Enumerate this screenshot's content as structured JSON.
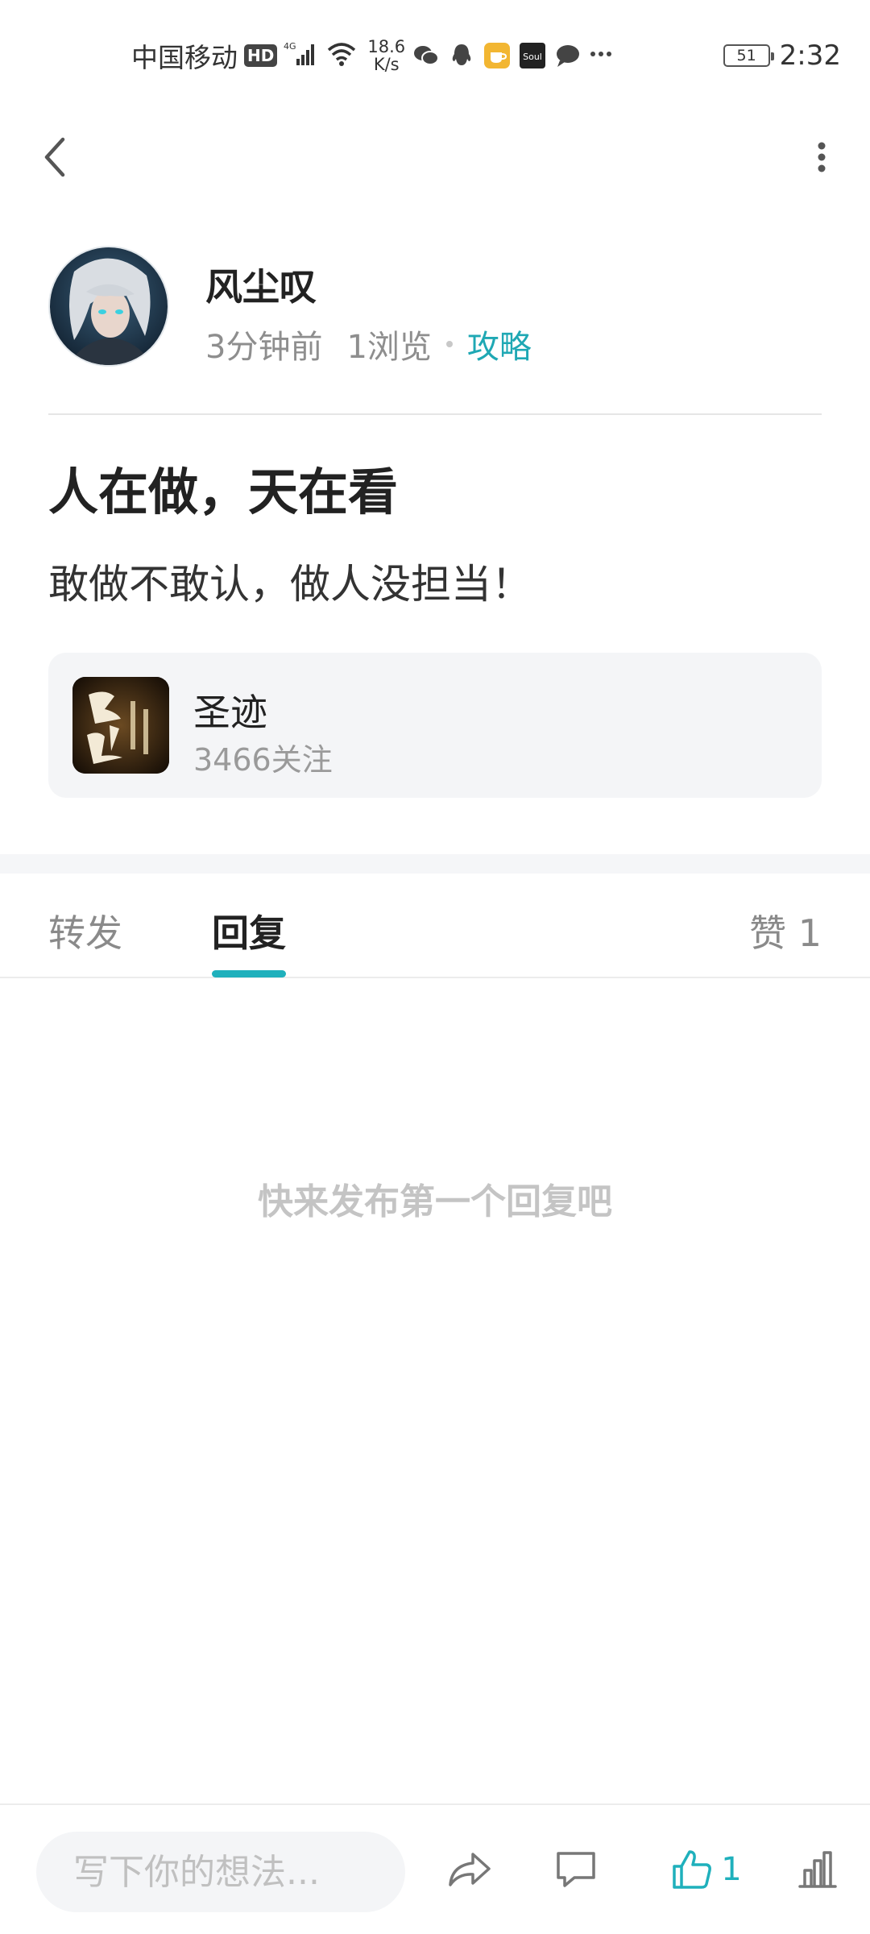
{
  "status_bar": {
    "carrier": "中国移动",
    "hd": "HD",
    "network": "4G",
    "net_speed_value": "18.6",
    "net_speed_unit": "K/s",
    "app_icons": [
      "wechat-icon",
      "qq-icon",
      "cup-app-icon",
      "soul-app-icon",
      "message-icon",
      "more-dots-icon"
    ],
    "battery": "51",
    "time": "2:32"
  },
  "header": {
    "back_icon": "chevron-left-icon",
    "more_icon": "more-vertical-icon"
  },
  "author": {
    "name": "风尘叹",
    "time_ago": "3分钟前",
    "views": "1浏览",
    "tag": "攻略"
  },
  "post": {
    "title": "人在做，天在看",
    "body": "敢做不敢认，做人没担当！"
  },
  "game": {
    "name": "圣迹",
    "followers": "3466关注"
  },
  "tabs": {
    "forward": "转发",
    "reply": "回复",
    "like": "赞 1",
    "active": "reply"
  },
  "replies": {
    "empty_hint": "快来发布第一个回复吧"
  },
  "bottom_bar": {
    "input_placeholder": "写下你的想法...",
    "like_count": "1",
    "accent_color": "#1fb0bc"
  }
}
